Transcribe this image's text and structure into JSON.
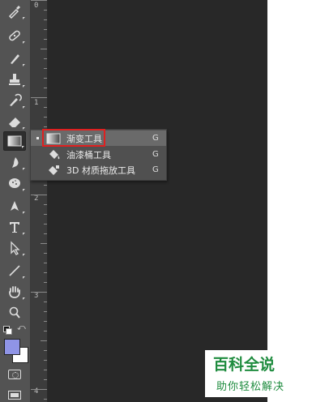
{
  "ruler": {
    "marks": [
      "0",
      "1",
      "2",
      "3",
      "4"
    ]
  },
  "tools": [
    {
      "name": "eyedropper-tool"
    },
    {
      "name": "spot-healing-brush-tool"
    },
    {
      "name": "brush-tool"
    },
    {
      "name": "clone-stamp-tool"
    },
    {
      "name": "history-brush-tool"
    },
    {
      "name": "eraser-tool"
    },
    {
      "name": "gradient-tool"
    },
    {
      "name": "blur-tool"
    },
    {
      "name": "dodge-tool"
    },
    {
      "name": "pen-tool"
    },
    {
      "name": "type-tool"
    },
    {
      "name": "path-selection-tool"
    },
    {
      "name": "line-tool"
    },
    {
      "name": "hand-tool"
    },
    {
      "name": "zoom-tool"
    }
  ],
  "flyout": {
    "items": [
      {
        "label": "渐变工具",
        "shortcut": "G",
        "selected": true,
        "icon": "gradient-icon"
      },
      {
        "label": "油漆桶工具",
        "shortcut": "G",
        "selected": false,
        "icon": "paint-bucket-icon"
      },
      {
        "label": "3D 材质拖放工具",
        "shortcut": "G",
        "selected": false,
        "icon": "3d-material-drop-icon"
      }
    ]
  },
  "colors": {
    "foreground": "#8f94e6",
    "background": "#ffffff",
    "highlight": "#e02020",
    "watermark": "#1f8c3f"
  },
  "watermark": {
    "title": "百科全说",
    "subtitle": "助你轻松解决"
  }
}
